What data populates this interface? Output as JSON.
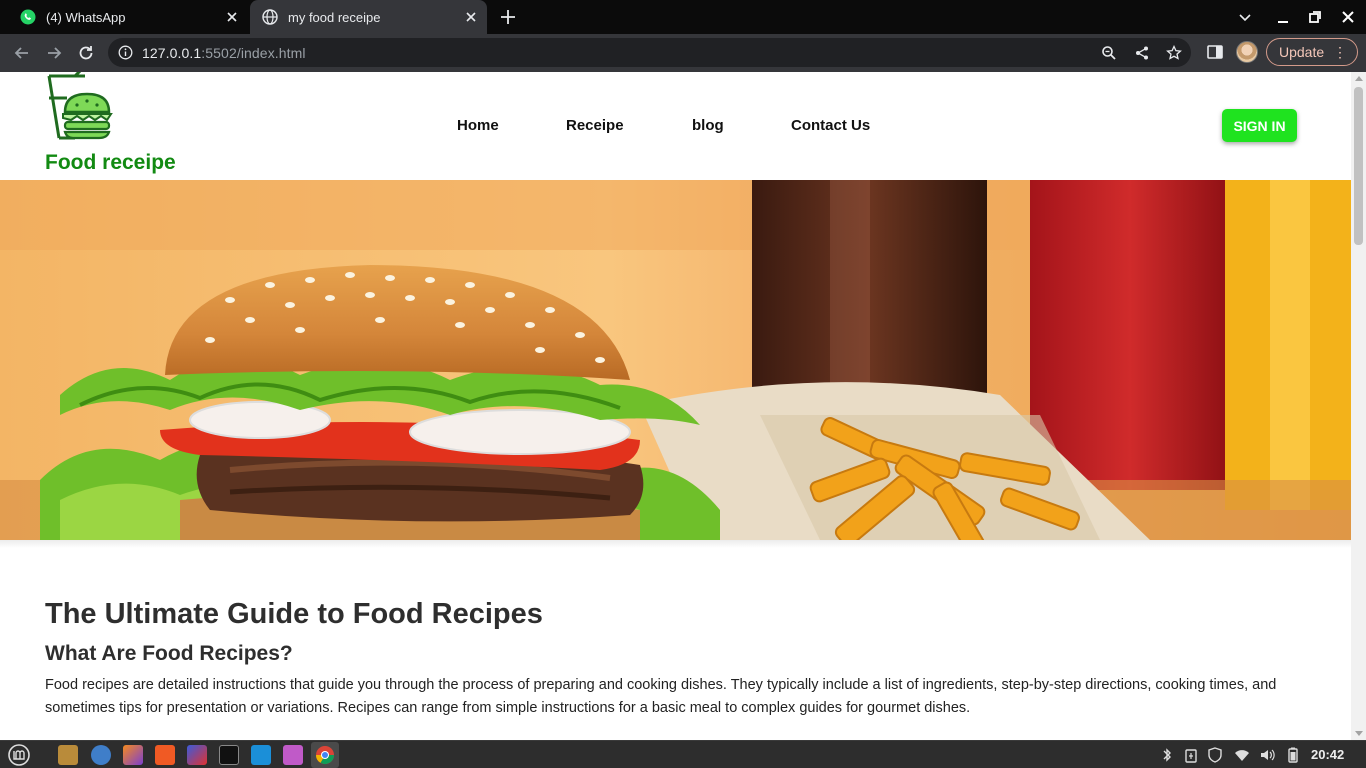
{
  "browser": {
    "tabs": [
      {
        "title": "(4) WhatsApp",
        "icon": "whatsapp-icon",
        "active": false
      },
      {
        "title": "my food receipe",
        "icon": "globe-icon",
        "active": true
      }
    ],
    "url_host": "127.0.0.1",
    "url_rest": ":5502/index.html",
    "update_label": "Update"
  },
  "site": {
    "name": "Food receipe",
    "nav": [
      "Home",
      "Receipe",
      "blog",
      "Contact Us"
    ],
    "signin_label": "SIGN IN",
    "accent_color": "#1fe31f",
    "brand_color": "#128a12"
  },
  "content": {
    "heading": "The Ultimate Guide to Food Recipes",
    "subheading": "What Are Food Recipes?",
    "paragraph": "Food recipes are detailed instructions that guide you through the process of preparing and cooking dishes. They typically include a list of ingredients, step-by-step directions, cooking times, and sometimes tips for presentation or variations. Recipes can range from simple instructions for a basic meal to complex guides for gourmet dishes."
  },
  "taskbar": {
    "clock": "20:42"
  }
}
